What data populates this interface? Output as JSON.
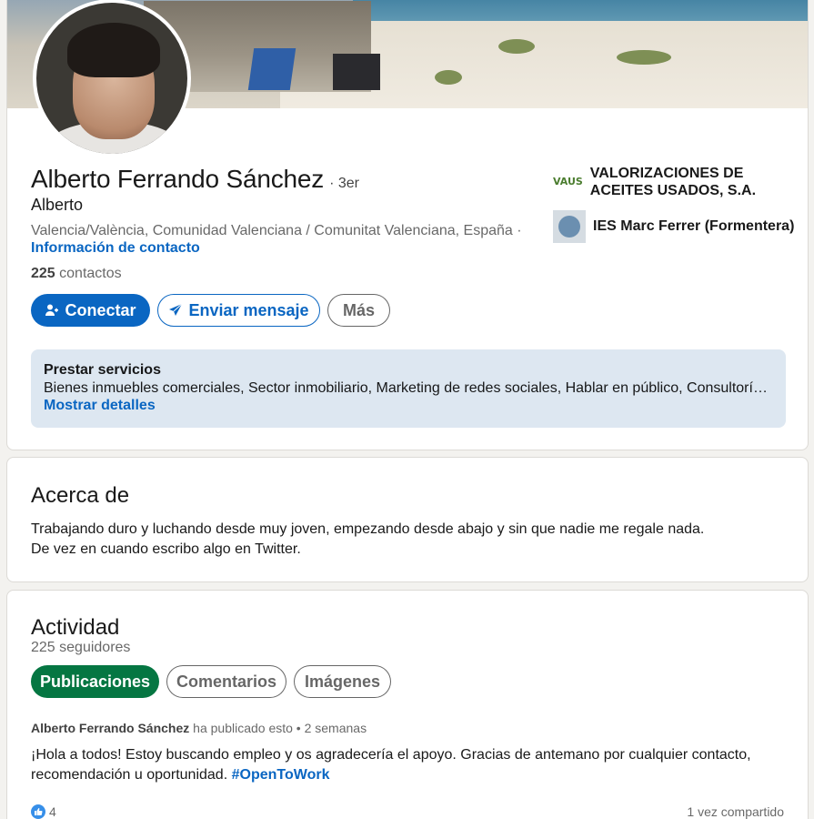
{
  "profile": {
    "name": "Alberto Ferrando Sánchez",
    "degree": "· 3er",
    "headline": "Alberto",
    "location": "Valencia/València, Comunidad Valenciana / Comunitat Valenciana, España ·",
    "contact_info_link": "Información de contacto",
    "connections_count": "225",
    "connections_label": "contactos",
    "buttons": {
      "connect": "Conectar",
      "message": "Enviar mensaje",
      "more": "Más"
    },
    "experience": [
      {
        "logo_text": "VAUS",
        "name": "VALORIZACIONES DE ACEITES USADOS, S.A."
      },
      {
        "name": "IES Marc Ferrer (Formentera)"
      }
    ],
    "services": {
      "title": "Prestar servicios",
      "list": "Bienes inmuebles comerciales, Sector inmobiliario, Marketing de redes sociales, Hablar en público, Consultoría política",
      "show_details": "Mostrar detalles"
    }
  },
  "about": {
    "title": "Acerca de",
    "line1": "Trabajando duro y luchando desde muy joven, empezando desde abajo y sin que nadie me regale nada.",
    "line2": "De vez en cuando escribo algo en Twitter."
  },
  "activity": {
    "title": "Actividad",
    "followers": "225 seguidores",
    "tabs": [
      "Publicaciones",
      "Comentarios",
      "Imágenes"
    ],
    "post": {
      "author": "Alberto Ferrando Sánchez",
      "meta": "ha publicado esto • 2 semanas",
      "text": "¡Hola a todos! Estoy buscando empleo y os agradecería el apoyo. Gracias de antemano por cualquier contacto, recomendación u oportunidad.",
      "hashtag": "#OpenToWork",
      "reactions": "4",
      "shares": "1 vez compartido"
    }
  },
  "colors": {
    "accent": "#0a66c2",
    "active_tab": "#057642",
    "services_bg": "#dde7f1"
  }
}
